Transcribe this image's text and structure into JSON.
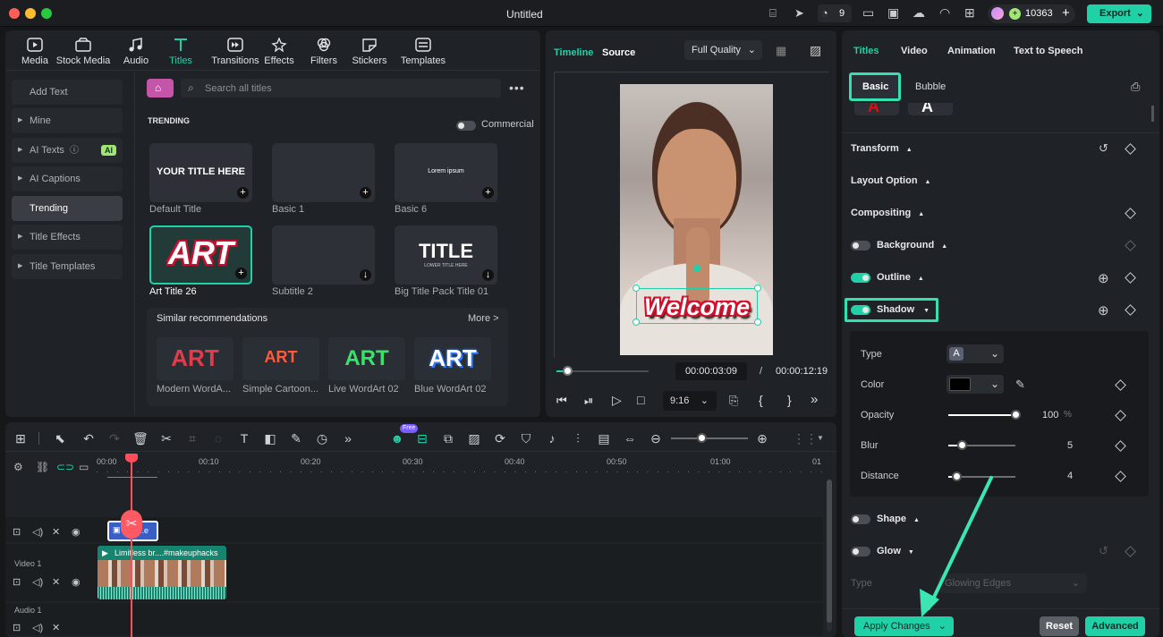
{
  "window": {
    "title": "Untitled",
    "credits": "10363",
    "export_label": "Export",
    "notif_count": "9"
  },
  "media_tabs": [
    {
      "label": "Media"
    },
    {
      "label": "Stock Media"
    },
    {
      "label": "Audio"
    },
    {
      "label": "Titles"
    },
    {
      "label": "Transitions"
    },
    {
      "label": "Effects"
    },
    {
      "label": "Filters"
    },
    {
      "label": "Stickers"
    },
    {
      "label": "Templates"
    }
  ],
  "sidebar": {
    "items": [
      {
        "label": "Add Text"
      },
      {
        "label": "Mine"
      },
      {
        "label": "AI Texts"
      },
      {
        "label": "AI Captions"
      },
      {
        "label": "Trending"
      },
      {
        "label": "Title Effects"
      },
      {
        "label": "Title Templates"
      }
    ],
    "ai_badge": "AI"
  },
  "browser": {
    "search_placeholder": "Search all titles",
    "section": "TRENDING",
    "commercial_label": "Commercial",
    "cards": [
      {
        "name": "Default Title",
        "preview": "YOUR TITLE HERE"
      },
      {
        "name": "Basic 1",
        "preview": ""
      },
      {
        "name": "Basic 6",
        "preview": "Lorem ipsum"
      },
      {
        "name": "Art Title 26",
        "preview": "ART"
      },
      {
        "name": "Subtitle 2",
        "preview": ""
      },
      {
        "name": "Big Title Pack Title 01",
        "preview": "TITLE",
        "sub": "LOWER TITLE HERE"
      }
    ],
    "similar_label": "Similar recommendations",
    "more_label": "More >",
    "recs": [
      {
        "name": "Modern WordA...",
        "preview": "ART"
      },
      {
        "name": "Simple Cartoon...",
        "preview": "ART"
      },
      {
        "name": "Live WordArt 02",
        "preview": "ART"
      },
      {
        "name": "Blue WordArt 02",
        "preview": "ART"
      }
    ]
  },
  "player": {
    "tab_timeline": "Timeline",
    "tab_source": "Source",
    "quality": "Full Quality",
    "caption": "Welcome",
    "current_time": "00:00:03:09",
    "separator": "/",
    "total_time": "00:00:12:19",
    "ratio": "9:16",
    "progress": 0.12
  },
  "right_panel": {
    "tabs": [
      {
        "label": "Titles"
      },
      {
        "label": "Video"
      },
      {
        "label": "Animation"
      },
      {
        "label": "Text to Speech"
      }
    ],
    "sub_basic": "Basic",
    "sub_bubble": "Bubble",
    "sections": {
      "transform": "Transform",
      "layout": "Layout Option",
      "compositing": "Compositing",
      "background": "Background",
      "outline": "Outline",
      "shadow": "Shadow",
      "shape": "Shape",
      "glow": "Glow"
    },
    "shadow": {
      "type_label": "Type",
      "type_value": "A",
      "color_label": "Color",
      "color_value": "#000000",
      "opacity_label": "Opacity",
      "opacity_value": "100",
      "opacity_unit": "%",
      "opacity": 1.0,
      "blur_label": "Blur",
      "blur_value": "5",
      "blur": 0.2,
      "distance_label": "Distance",
      "distance_value": "4",
      "distance": 0.12
    },
    "glow": {
      "type_label": "Type",
      "type_value": "Glowing Edges"
    },
    "apply_label": "Apply Changes",
    "reset_label": "Reset",
    "advanced_label": "Advanced"
  },
  "timeline": {
    "ruler": [
      "00:00",
      "00:10",
      "00:20",
      "00:30",
      "00:40",
      "00:50",
      "01:00",
      "01"
    ],
    "video_track_label": "Video 1",
    "audio_track_label": "Audio 1",
    "video_clip_label": "Limitless br....#makeuphacks",
    "title_clip_label": "..e",
    "badge": "Free"
  },
  "colors": {
    "accent": "#20d1a8",
    "bg": "#151719"
  }
}
